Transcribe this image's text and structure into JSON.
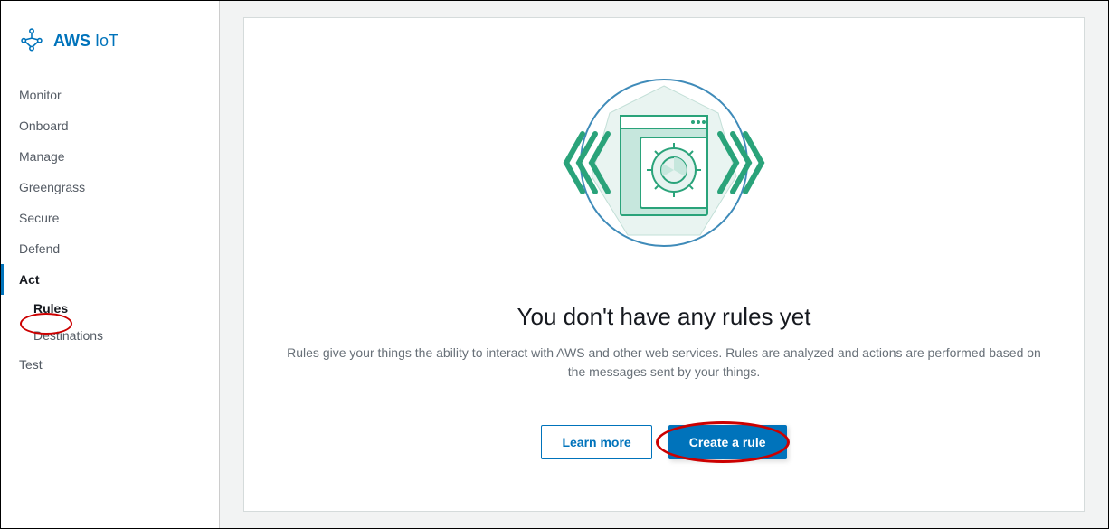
{
  "logo": {
    "brand": "AWS",
    "product": "IoT"
  },
  "sidebar": {
    "items": [
      {
        "label": "Monitor"
      },
      {
        "label": "Onboard"
      },
      {
        "label": "Manage"
      },
      {
        "label": "Greengrass"
      },
      {
        "label": "Secure"
      },
      {
        "label": "Defend"
      },
      {
        "label": "Act",
        "active": true
      },
      {
        "label": "Test"
      }
    ],
    "act_subitems": [
      {
        "label": "Rules",
        "selected": true
      },
      {
        "label": "Destinations"
      }
    ]
  },
  "empty_state": {
    "title": "You don't have any rules yet",
    "description": "Rules give your things the ability to interact with AWS and other web services. Rules are analyzed and actions are performed based on the messages sent by your things.",
    "learn_more_label": "Learn more",
    "create_label": "Create a rule"
  }
}
